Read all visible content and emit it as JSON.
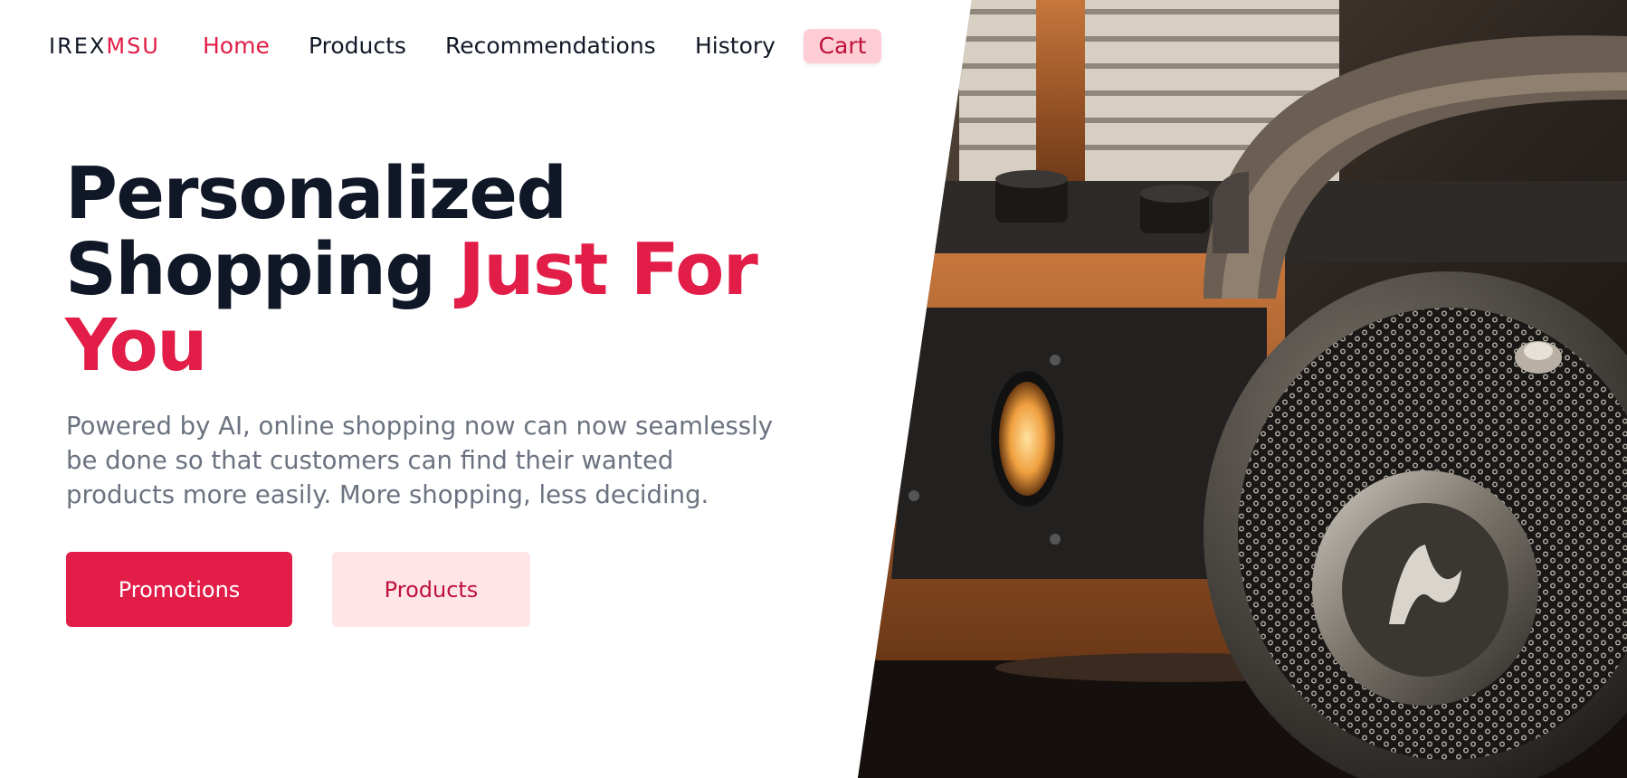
{
  "brand": {
    "part1": "IREX",
    "part2": "MSU"
  },
  "nav": {
    "items": [
      {
        "label": "Home",
        "active": true
      },
      {
        "label": "Products",
        "active": false
      },
      {
        "label": "Recommendations",
        "active": false
      },
      {
        "label": "History",
        "active": false
      }
    ],
    "cart_label": "Cart"
  },
  "hero": {
    "headline_line1": "Personalized",
    "headline_line2_plain": "Shopping",
    "headline_line2_accent": "Just For",
    "headline_line3_accent": "You",
    "description": "Powered by AI, online shopping now can now seamlessly be done so that customers can find their wanted products more easily. More shopping, less deciding.",
    "primary_button": "Promotions",
    "secondary_button": "Products"
  },
  "colors": {
    "accent": "#e11d48",
    "heading": "#101828",
    "body_text": "#6b7280",
    "cart_bg": "#fecdd5",
    "secondary_button_bg": "#ffe4e8"
  }
}
